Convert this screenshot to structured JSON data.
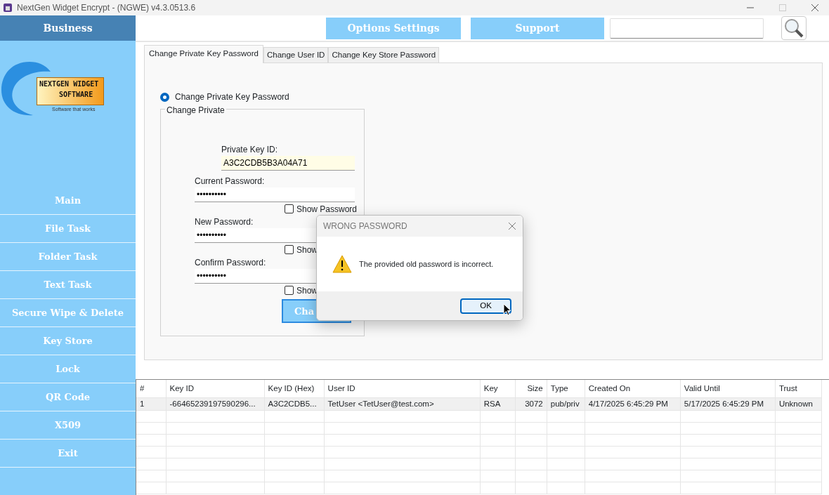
{
  "window": {
    "title": "NextGen Widget Encrypt - (NGWE) v4.3.0513.6"
  },
  "sidebar": {
    "header": "Business",
    "logo": {
      "line_1": "NEXTGEN WIDGET",
      "line_2": "SOFTWARE",
      "tagline": "Software that works"
    },
    "items": [
      {
        "label": "Main"
      },
      {
        "label": "File Task"
      },
      {
        "label": "Folder Task"
      },
      {
        "label": "Text Task"
      },
      {
        "label": "Secure Wipe & Delete"
      },
      {
        "label": "Key Store"
      },
      {
        "label": "Lock"
      },
      {
        "label": "QR Code"
      },
      {
        "label": "X509"
      },
      {
        "label": "Exit"
      }
    ]
  },
  "toolbar": {
    "buttons": [
      "Options Settings",
      "Support"
    ]
  },
  "tabs": [
    {
      "label": "Change Private Key Password",
      "selected": true
    },
    {
      "label": "Change User ID",
      "selected": false
    },
    {
      "label": "Change Key Store Password",
      "selected": false
    }
  ],
  "form": {
    "radio": {
      "label": "Change Private Key Password",
      "selected": true
    },
    "group_title": "Change Private",
    "key_id": {
      "label": "Private Key ID:",
      "value": "A3C2CDB5B3A04A71"
    },
    "fields": [
      {
        "label": "Current Password:",
        "value": "••••••••••",
        "show_label": "Show Password",
        "show_checked": false
      },
      {
        "label": "New Password:",
        "value": "••••••••••",
        "show_label": "Show",
        "show_checked": false
      },
      {
        "label": "Confirm Password:",
        "value": "••••••••••",
        "show_label": "Show",
        "show_checked": false
      }
    ],
    "submit": "Cha"
  },
  "dialog": {
    "title": "WRONG PASSWORD",
    "message": "The provided old password is incorrect.",
    "button": "OK"
  },
  "table": {
    "columns": [
      "#",
      "Key ID",
      "Key ID (Hex)",
      "User ID",
      "Key",
      "Size",
      "Type",
      "Created On",
      "Valid Until",
      "Trust"
    ],
    "rows": [
      [
        "1",
        "-66465239197590296...",
        "A3C2CDB5...",
        "TetUser <TetUser@test.com>",
        "RSA",
        "3072",
        "pub/priv",
        "4/17/2025 6:45:29 PM",
        "5/17/2025 6:45:29 PM",
        "Unknown"
      ]
    ]
  }
}
